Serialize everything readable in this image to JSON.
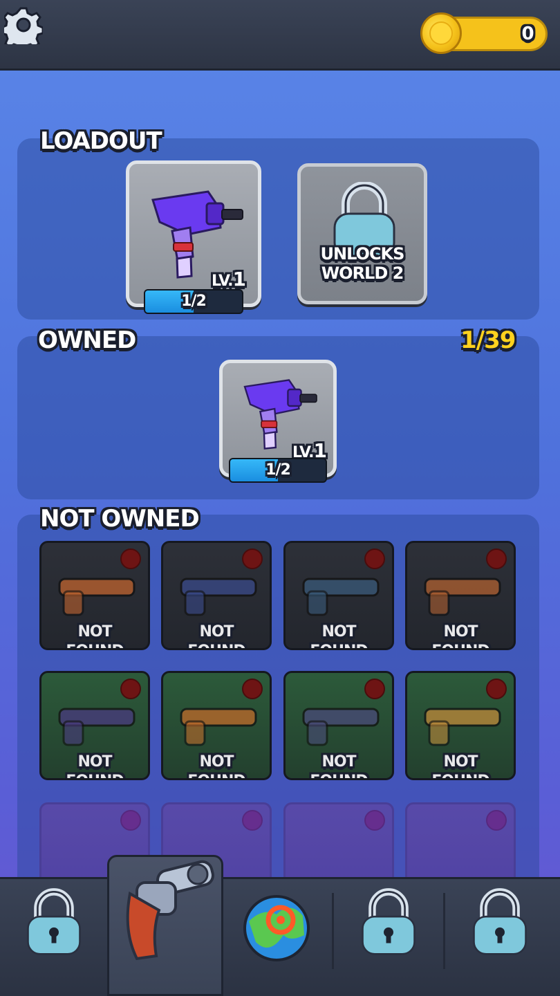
{
  "header": {
    "settings_icon": "gear-icon",
    "coins": "0"
  },
  "loadout": {
    "title": "LOADOUT",
    "slot1": {
      "weapon_icon": "purple-smg-icon",
      "level_prefix": "LV.",
      "level": "1",
      "progress_text": "1/2",
      "progress_fraction": 0.5
    },
    "slot2": {
      "locked_icon": "padlock-icon",
      "line1": "UNLOCKS",
      "line2": "WORLD 2"
    }
  },
  "owned": {
    "title": "OWNED",
    "count": "1/39",
    "items": [
      {
        "weapon_icon": "purple-smg-icon",
        "level_prefix": "LV.",
        "level": "1",
        "progress_text": "1/2",
        "progress_fraction": 0.5
      }
    ]
  },
  "not_owned": {
    "title": "NOT OWNED",
    "items": [
      {
        "icon": "cleaver-icon",
        "line1": "NOT",
        "line2": "FOUND",
        "color": "#c0632e"
      },
      {
        "icon": "revolver-icon",
        "line1": "NOT",
        "line2": "FOUND",
        "color": "#3a4a8a"
      },
      {
        "icon": "grenade-icon",
        "line1": "NOT",
        "line2": "FOUND",
        "color": "#3a5a7a"
      },
      {
        "icon": "rifle-icon",
        "line1": "NOT",
        "line2": "FOUND",
        "color": "#b06030"
      },
      {
        "icon": "shotgun-icon",
        "line1": "NOT",
        "line2": "FOUND",
        "color": "#4a3a80"
      },
      {
        "icon": "pistol-icon",
        "line1": "NOT",
        "line2": "FOUND",
        "color": "#c06a2a"
      },
      {
        "icon": "magnum-icon",
        "line1": "NOT",
        "line2": "FOUND",
        "color": "#4a4a7a"
      },
      {
        "icon": "assault-rifle-icon",
        "line1": "NOT",
        "line2": "FOUND",
        "color": "#c08a3a"
      }
    ]
  },
  "nav": {
    "items": [
      "locked-tab-icon",
      "weapons-tab-icon",
      "world-map-tab-icon",
      "locked-tab-icon",
      "locked-tab-icon"
    ],
    "active_index": 1
  }
}
